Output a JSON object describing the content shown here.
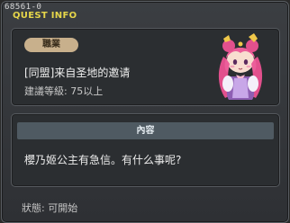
{
  "window": {
    "id": "68561-0",
    "title": "QUEST INFO"
  },
  "quest": {
    "category": "職業",
    "name": "[同盟]来自圣地的邀请",
    "level_requirement": "建議等級: 75以上",
    "npc": "sakuno-princess-icon"
  },
  "content": {
    "header": "內容",
    "text": "櫻乃姬公主有急信。有什么事呢?"
  },
  "status": "狀態: 可開始",
  "colors": {
    "title": "#e6d64a",
    "badge": "#c8b08c",
    "header": "#4f5a62"
  }
}
